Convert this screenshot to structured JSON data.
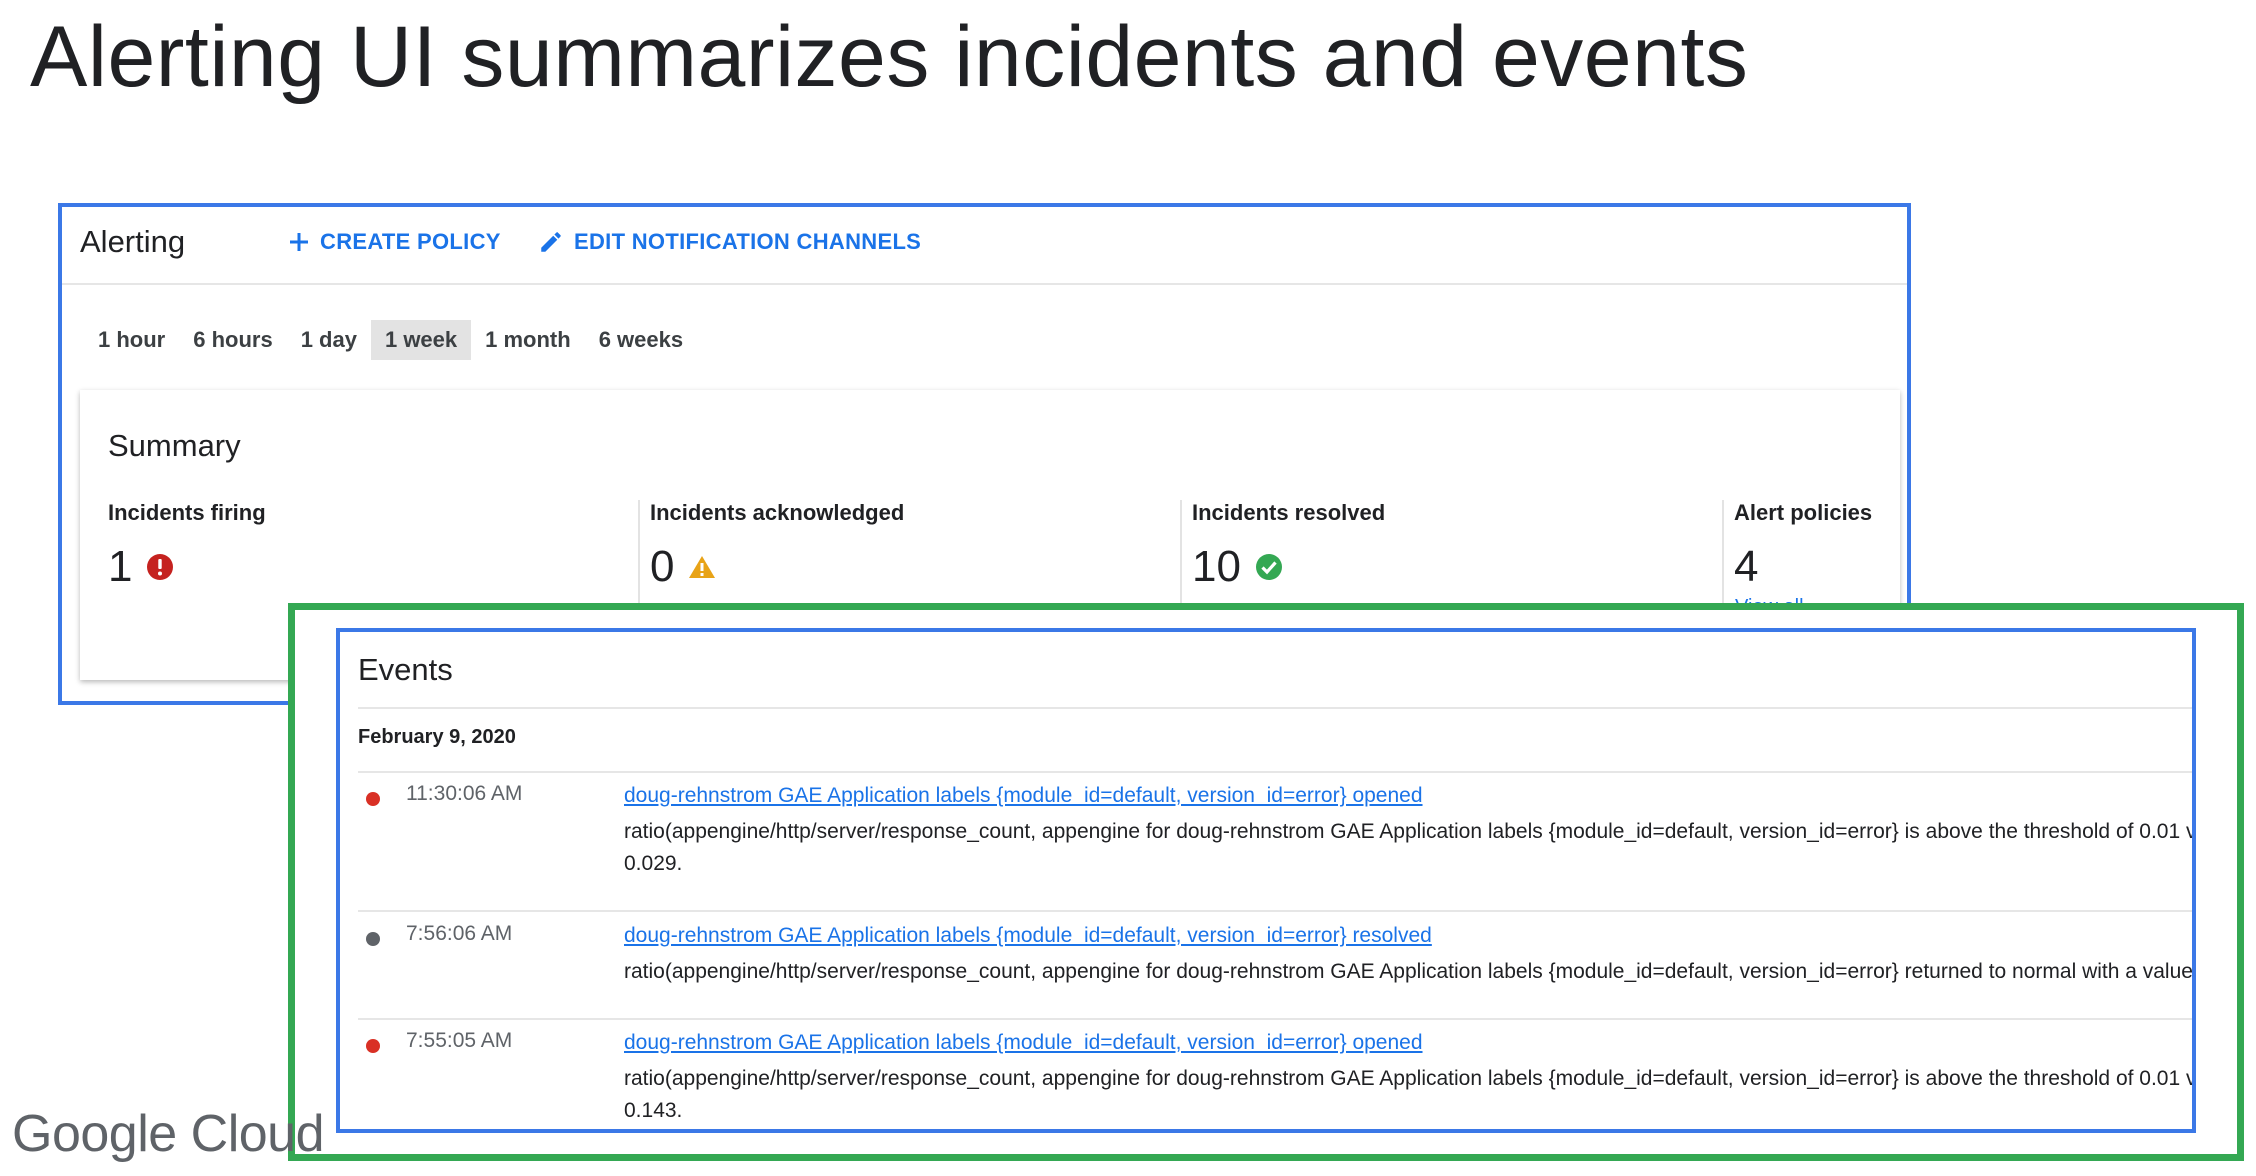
{
  "slide": {
    "title": "Alerting UI summarizes incidents and events",
    "logo_text_google": "Google",
    "logo_text_cloud": "Cloud"
  },
  "alerting": {
    "title": "Alerting",
    "create_policy": "CREATE POLICY",
    "edit_channels": "EDIT NOTIFICATION CHANNELS",
    "time_ranges": [
      "1 hour",
      "6 hours",
      "1 day",
      "1 week",
      "1 month",
      "6 weeks"
    ],
    "selected_time_range": "1 week",
    "summary": {
      "title": "Summary",
      "metrics": [
        {
          "label": "Incidents firing",
          "value": "1",
          "icon": "error-icon",
          "color": "#c5221f"
        },
        {
          "label": "Incidents acknowledged",
          "value": "0",
          "icon": "warning-icon",
          "color": "#e8a317"
        },
        {
          "label": "Incidents resolved",
          "value": "10",
          "icon": "check-circle-icon",
          "color": "#34a853"
        },
        {
          "label": "Alert policies",
          "value": "4",
          "icon": "",
          "color": ""
        }
      ],
      "view_all": "View all"
    }
  },
  "events": {
    "title": "Events",
    "date": "February 9, 2020",
    "items": [
      {
        "time": "11:30:06 AM",
        "status_color": "#d93025",
        "link": "doug-rehnstrom GAE Application labels {module_id=default, version_id=error} opened",
        "description": "ratio(appengine/http/server/response_count, appengine for doug-rehnstrom GAE Application labels {module_id=default, version_id=error} is above the threshold of 0.01 v",
        "description_line2": "0.029."
      },
      {
        "time": "7:56:06 AM",
        "status_color": "#5f6368",
        "link": "doug-rehnstrom GAE Application labels {module_id=default, version_id=error} resolved",
        "description": "ratio(appengine/http/server/response_count, appengine for doug-rehnstrom GAE Application labels {module_id=default, version_id=error} returned to normal with a value",
        "description_line2": ""
      },
      {
        "time": "7:55:05 AM",
        "status_color": "#d93025",
        "link": "doug-rehnstrom GAE Application labels {module_id=default, version_id=error} opened",
        "description": "ratio(appengine/http/server/response_count, appengine for doug-rehnstrom GAE Application labels {module_id=default, version_id=error} is above the threshold of 0.01 v",
        "description_line2": "0.143."
      }
    ]
  },
  "colors": {
    "frame_blue": "#3b78e7",
    "frame_green": "#34a853",
    "link_blue": "#1a73e8"
  }
}
